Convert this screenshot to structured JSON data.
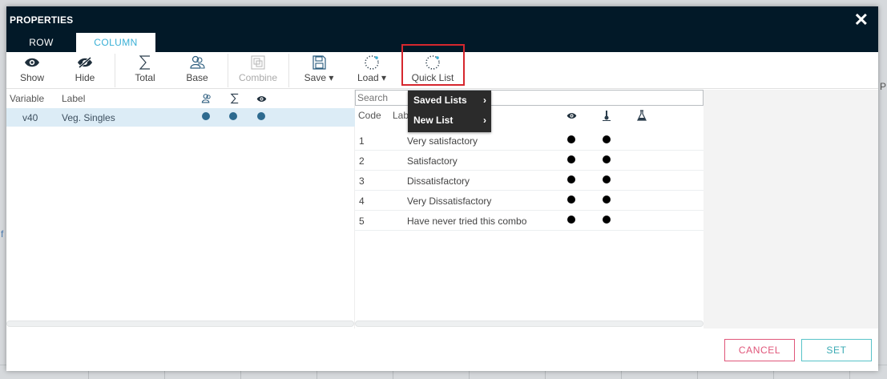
{
  "dialog": {
    "title": "PROPERTIES",
    "close": "✕",
    "tabs": [
      {
        "label": "ROW",
        "active": false
      },
      {
        "label": "COLUMN",
        "active": true
      }
    ]
  },
  "toolbar": {
    "show": "Show",
    "hide": "Hide",
    "total": "Total",
    "base": "Base",
    "combine": "Combine",
    "save": "Save ▾",
    "load": "Load ▾",
    "quick_list": "Quick List"
  },
  "icons": {
    "show": "eye-icon",
    "hide": "eye-slash-icon",
    "total": "sigma-icon",
    "base": "users-icon",
    "combine": "combine-icon",
    "save": "save-icon",
    "load": "dotted-circle-icon",
    "quick_list": "dotted-circle-icon"
  },
  "variables": {
    "headers": {
      "variable": "Variable",
      "label": "Label"
    },
    "rows": [
      {
        "variable": "v40",
        "label": "Veg. Singles",
        "base": true,
        "total": true,
        "show": true
      }
    ]
  },
  "codes": {
    "search_placeholder": "Search",
    "headers": {
      "code": "Code",
      "label": "Lab"
    },
    "rows": [
      {
        "code": "1",
        "label": "Very satisfactory",
        "show": true,
        "rank": true
      },
      {
        "code": "2",
        "label": "Satisfactory",
        "show": true,
        "rank": true
      },
      {
        "code": "3",
        "label": "Dissatisfactory",
        "show": true,
        "rank": true
      },
      {
        "code": "4",
        "label": "Very Dissatisfactory",
        "show": true,
        "rank": true
      },
      {
        "code": "5",
        "label": "Have never tried this combo",
        "show": true,
        "rank": true
      }
    ]
  },
  "menu": {
    "items": [
      {
        "label": "Saved Lists",
        "chevron": "›"
      },
      {
        "label": "New List",
        "chevron": "›"
      }
    ]
  },
  "footer": {
    "cancel": "CANCEL",
    "set": "SET"
  },
  "background": {
    "fragment_left": "f",
    "fragment_right": "P"
  },
  "colors": {
    "titlebar": "#021928",
    "accent": "#3ab0d6",
    "highlight": "#d6272e",
    "cancel": "#e0567a",
    "set": "#58c3c9",
    "selected_row": "#dcecf6"
  }
}
